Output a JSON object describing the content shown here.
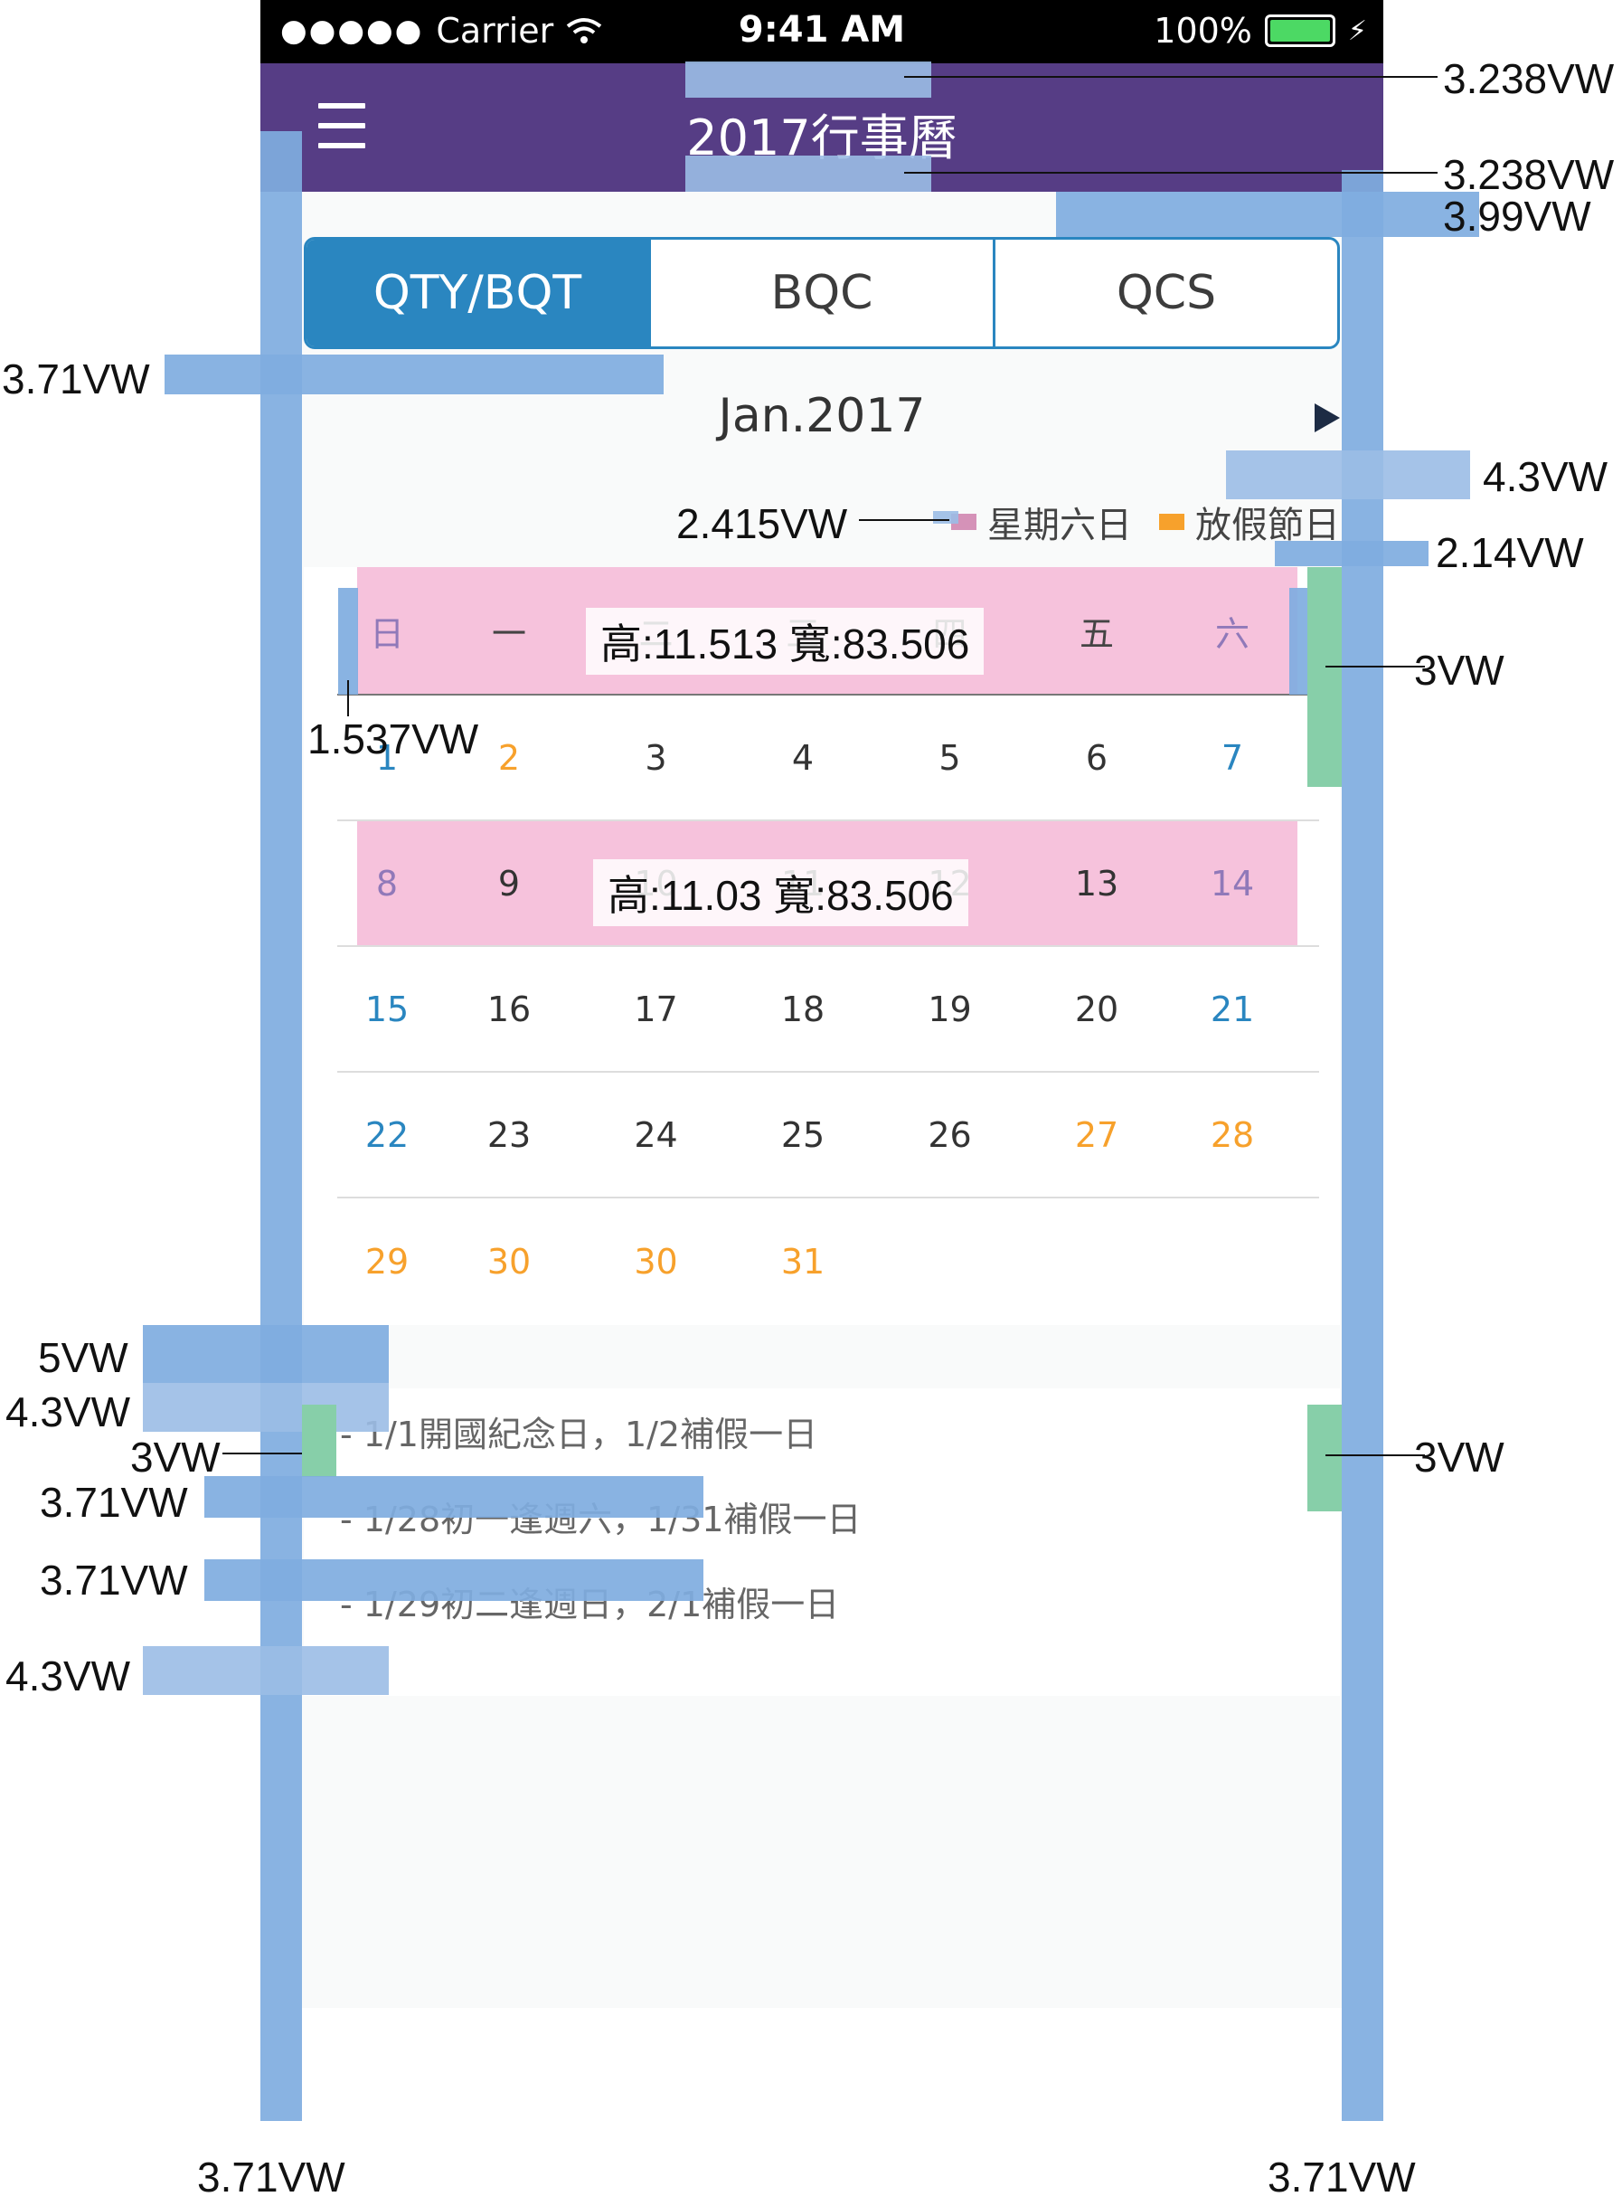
{
  "status_bar": {
    "signal": "●●●●●",
    "carrier": "Carrier",
    "wifi_icon": "wifi-icon",
    "time": "9:41 AM",
    "battery": "100%"
  },
  "header": {
    "title": "2017行事曆",
    "menu_icon": "hamburger-icon"
  },
  "tabs": [
    {
      "label": "QTY/BQT",
      "active": true
    },
    {
      "label": "BQC",
      "active": false
    },
    {
      "label": "QCS",
      "active": false
    }
  ],
  "calendar": {
    "month_label": "Jan.2017",
    "legend": {
      "weekend": "星期六日",
      "holiday": "放假節日"
    },
    "weekdays": [
      "日",
      "一",
      "二",
      "三",
      "四",
      "五",
      "六"
    ],
    "weeks": [
      [
        "1",
        "2",
        "3",
        "4",
        "5",
        "6",
        "7"
      ],
      [
        "8",
        "9",
        "10",
        "11",
        "12",
        "13",
        "14"
      ],
      [
        "15",
        "16",
        "17",
        "18",
        "19",
        "20",
        "21"
      ],
      [
        "22",
        "23",
        "24",
        "25",
        "26",
        "27",
        "28"
      ],
      [
        "29",
        "30",
        "30",
        "31",
        "",
        "",
        ""
      ]
    ]
  },
  "notes": [
    "- 1/1開國紀念日，1/2補假一日",
    "- 1/28初一逢週六，1/31補假一日",
    "- 1/29初二逢週日，2/1補假一日"
  ],
  "annotations": {
    "title_top": "3.238VW",
    "title_bottom": "3.238VW",
    "tabs_top": "3.99VW",
    "left_margin": "3.71VW",
    "month_gap": "4.3VW",
    "legend_swatch": "2.415VW",
    "legend_gap": "2.14VW",
    "header_right": "3VW",
    "header_left": "1.537VW",
    "header_measure": "高:11.513 寬:83.506",
    "row_measure": "高:11.03 寬:83.506",
    "notes_gap_a": "5VW",
    "notes_gap_b": "4.3VW",
    "notes_indent": "3VW",
    "notes_right": "3VW",
    "note_gap_1": "3.71VW",
    "note_gap_2": "3.71VW",
    "notes_bottom": "4.3VW",
    "bottom_left": "3.71VW",
    "bottom_right": "3.71VW"
  },
  "colors": {
    "header": "#563d85",
    "tab_active": "#2a86c0",
    "weekend_highlight": "#f6c2dc",
    "holiday": "#f7a12c",
    "weekend_text": "#2a86c0"
  }
}
